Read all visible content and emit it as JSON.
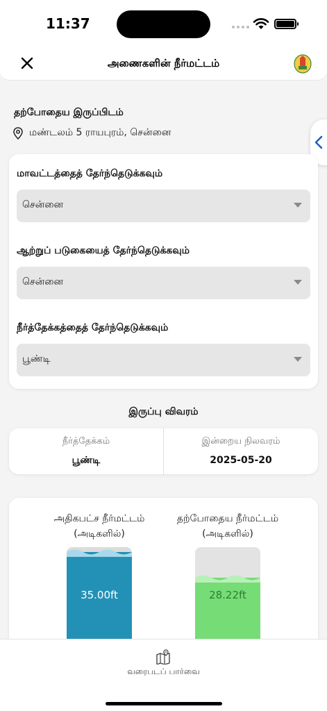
{
  "status": {
    "time": "11:37"
  },
  "header": {
    "title": "அணைகளின் நீர்மட்டம்"
  },
  "location": {
    "label": "தற்போதைய இருப்பிடம்",
    "address": "மண்டலம் 5 ராயபுரம், சென்னை"
  },
  "filters": [
    {
      "label": "மாவட்டத்தைத் தேர்ந்தெடுக்கவும்",
      "value": "சென்னை"
    },
    {
      "label": "ஆற்றுப் படுகையைத் தேர்ந்தெடுக்கவும்",
      "value": "சென்னை"
    },
    {
      "label": "நீர்த்தேக்கத்தைத் தேர்ந்தெடுக்கவும்",
      "value": "பூண்டி"
    }
  ],
  "details": {
    "heading": "இருப்பு விவரம்",
    "reservoir_label": "நீர்த்தேக்கம்",
    "reservoir_value": "பூண்டி",
    "date_label": "இன்றைய நிலவரம்",
    "date_value": "2025-05-20"
  },
  "levels": {
    "max": {
      "title_line1": "அதிகபட்ச நீர்மட்டம்",
      "title_line2": "(அடிகளில்)",
      "value": "35.00ft",
      "fill_fraction": 1.0,
      "color": "#2391b6",
      "wave_color": "#a9d8ec"
    },
    "current": {
      "title_line1": "தற்போதைய நீர்மட்டம்",
      "title_line2": "(அடிகளில்)",
      "value": "28.22ft",
      "fill_fraction": 0.8063,
      "color": "#76dc76",
      "wave_color": "#b9efb9"
    }
  },
  "bottom_nav": {
    "map_label": "வரைபடப் பார்வை"
  }
}
